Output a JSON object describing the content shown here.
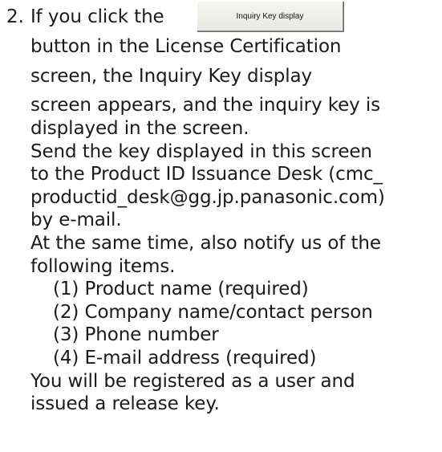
{
  "step": {
    "number": "2.",
    "intro": "If you click the",
    "button_label": "Inquiry Key display"
  },
  "lines": [
    "button in the License Certification",
    "screen, the Inquiry Key display",
    "screen appears, and the inquiry key is",
    "displayed in the screen.",
    "Send the key displayed in this screen",
    "to the Product ID Issuance Desk (cmc_",
    "productid_desk@gg.jp.panasonic.com)",
    "by e-mail.",
    "At the same time, also notify us of the",
    "following items."
  ],
  "items": [
    "(1) Product name (required)",
    "(2) Company name/contact person",
    "(3) Phone number",
    "(4) E-mail address (required)"
  ],
  "closing": [
    "You will be registered as a user and",
    "issued a release key."
  ]
}
